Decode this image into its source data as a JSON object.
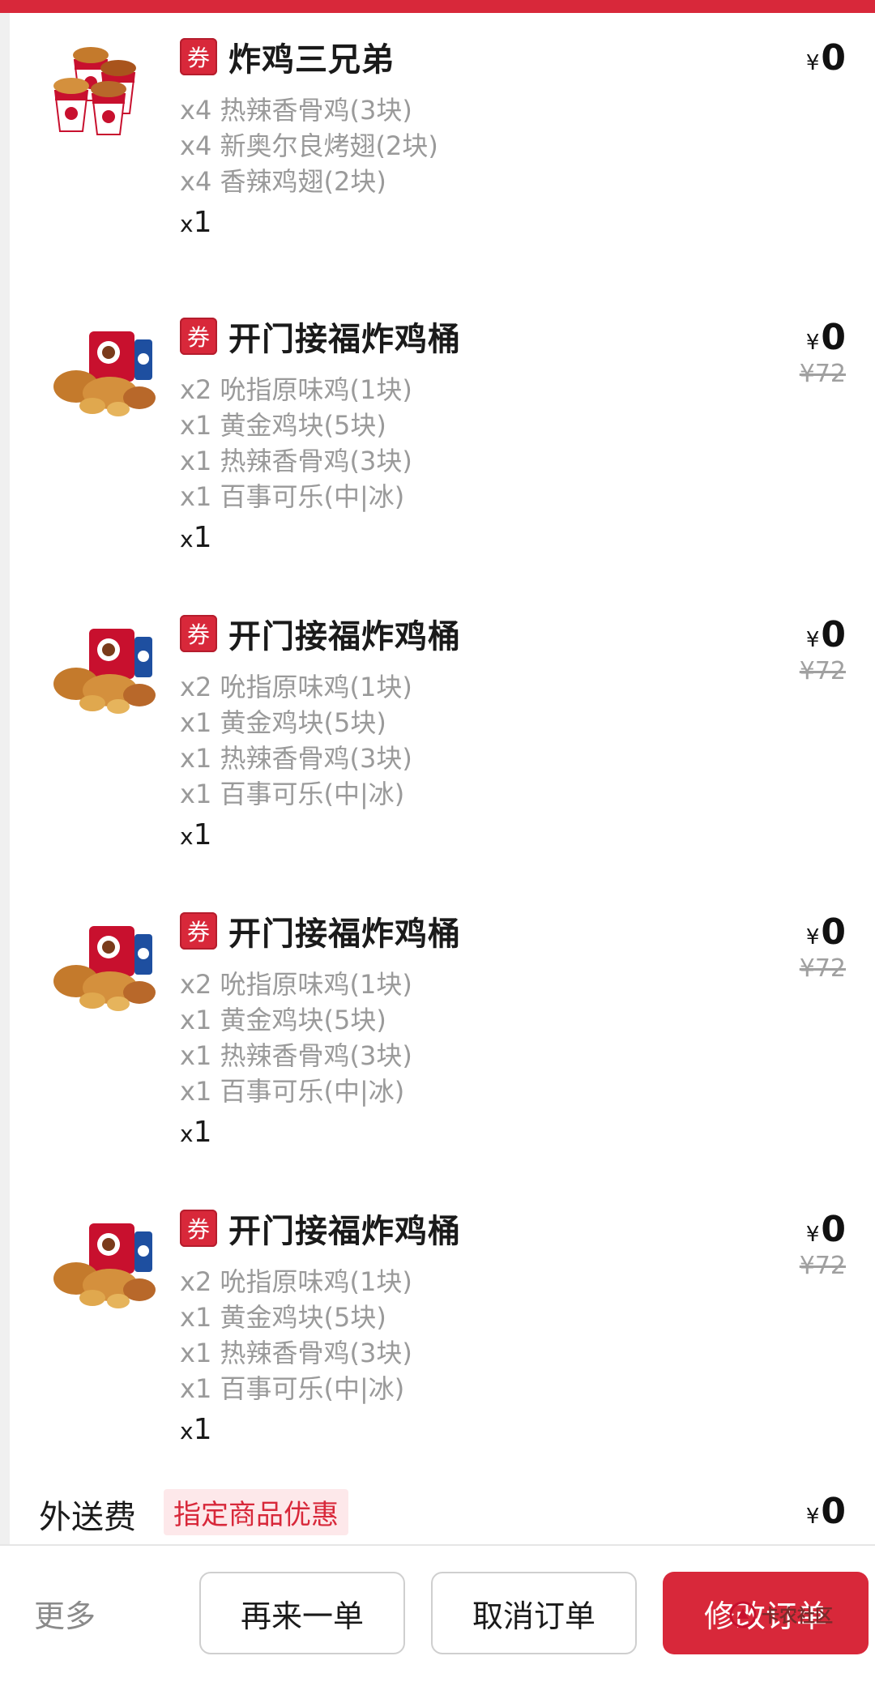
{
  "items": [
    {
      "name": "炸鸡三兄弟",
      "components": [
        "x4 热辣香骨鸡(3块)",
        "x4 新奥尔良烤翅(2块)",
        "x4 香辣鸡翅(2块)"
      ],
      "qty_prefix": "x",
      "qty": "1",
      "price_symbol": "¥",
      "price": "0",
      "original_price": ""
    },
    {
      "name": "开门接福炸鸡桶",
      "components": [
        "x2 吮指原味鸡(1块)",
        "x1 黄金鸡块(5块)",
        "x1 热辣香骨鸡(3块)",
        "x1 百事可乐(中|冰)"
      ],
      "qty_prefix": "x",
      "qty": "1",
      "price_symbol": "¥",
      "price": "0",
      "original_price": "¥72"
    },
    {
      "name": "开门接福炸鸡桶",
      "components": [
        "x2 吮指原味鸡(1块)",
        "x1 黄金鸡块(5块)",
        "x1 热辣香骨鸡(3块)",
        "x1 百事可乐(中|冰)"
      ],
      "qty_prefix": "x",
      "qty": "1",
      "price_symbol": "¥",
      "price": "0",
      "original_price": "¥72"
    },
    {
      "name": "开门接福炸鸡桶",
      "components": [
        "x2 吮指原味鸡(1块)",
        "x1 黄金鸡块(5块)",
        "x1 热辣香骨鸡(3块)",
        "x1 百事可乐(中|冰)"
      ],
      "qty_prefix": "x",
      "qty": "1",
      "price_symbol": "¥",
      "price": "0",
      "original_price": "¥72"
    },
    {
      "name": "开门接福炸鸡桶",
      "components": [
        "x2 吮指原味鸡(1块)",
        "x1 黄金鸡块(5块)",
        "x1 热辣香骨鸡(3块)",
        "x1 百事可乐(中|冰)"
      ],
      "qty_prefix": "x",
      "qty": "1",
      "price_symbol": "¥",
      "price": "0",
      "original_price": "¥72"
    }
  ],
  "coupon_badge": "券",
  "delivery": {
    "label": "外送费",
    "tag": "指定商品优惠",
    "price_symbol": "¥",
    "price": "0"
  },
  "bottom_bar": {
    "more": "更多",
    "reorder": "再来一单",
    "cancel": "取消订单",
    "modify": "修改订单"
  },
  "watermark": "卡农社区",
  "colors": {
    "accent": "#d8283a",
    "muted_text": "#9a9a9a",
    "tag_bg": "#fde8ea"
  },
  "icons": {
    "coupon": "coupon-badge-icon",
    "product_thumbnail": "fried-chicken-bucket-image"
  }
}
